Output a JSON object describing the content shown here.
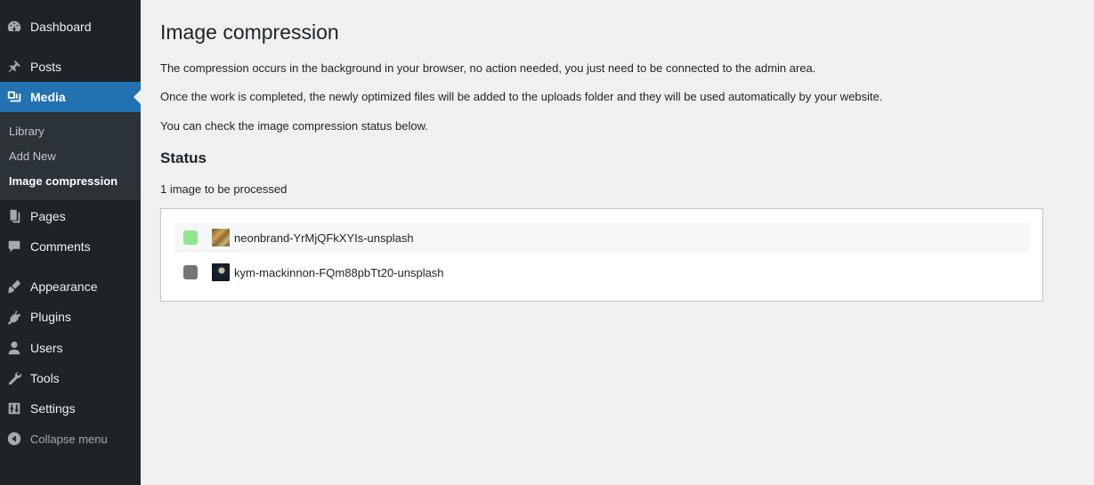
{
  "sidebar": {
    "items": [
      {
        "label": "Dashboard",
        "icon": "dashboard-icon"
      },
      {
        "label": "Posts",
        "icon": "pin-icon"
      },
      {
        "label": "Media",
        "icon": "media-icon"
      },
      {
        "label": "Pages",
        "icon": "pages-icon"
      },
      {
        "label": "Comments",
        "icon": "comment-icon"
      },
      {
        "label": "Appearance",
        "icon": "brush-icon"
      },
      {
        "label": "Plugins",
        "icon": "plugin-icon"
      },
      {
        "label": "Users",
        "icon": "user-icon"
      },
      {
        "label": "Tools",
        "icon": "wrench-icon"
      },
      {
        "label": "Settings",
        "icon": "settings-icon"
      }
    ],
    "submenu": [
      "Library",
      "Add New",
      "Image compression"
    ],
    "collapse_label": "Collapse menu"
  },
  "main": {
    "title": "Image compression",
    "paragraphs": [
      "The compression occurs in the background in your browser, no action needed, you just need to be connected to the admin area.",
      "Once the work is completed, the newly optimized files will be added to the uploads folder and they will be used automatically by your website.",
      "You can check the image compression status below."
    ],
    "status_heading": "Status",
    "status_count": "1 image to be processed",
    "images": [
      {
        "name": "neonbrand-YrMjQFkXYIs-unsplash",
        "status_color": "#8ee68e"
      },
      {
        "name": "kym-mackinnon-FQm88pbTt20-unsplash",
        "status_color": "#757575"
      }
    ]
  },
  "colors": {
    "sidebar_bg": "#1d2327",
    "accent": "#2271b1",
    "page_bg": "#f0f0f1"
  }
}
